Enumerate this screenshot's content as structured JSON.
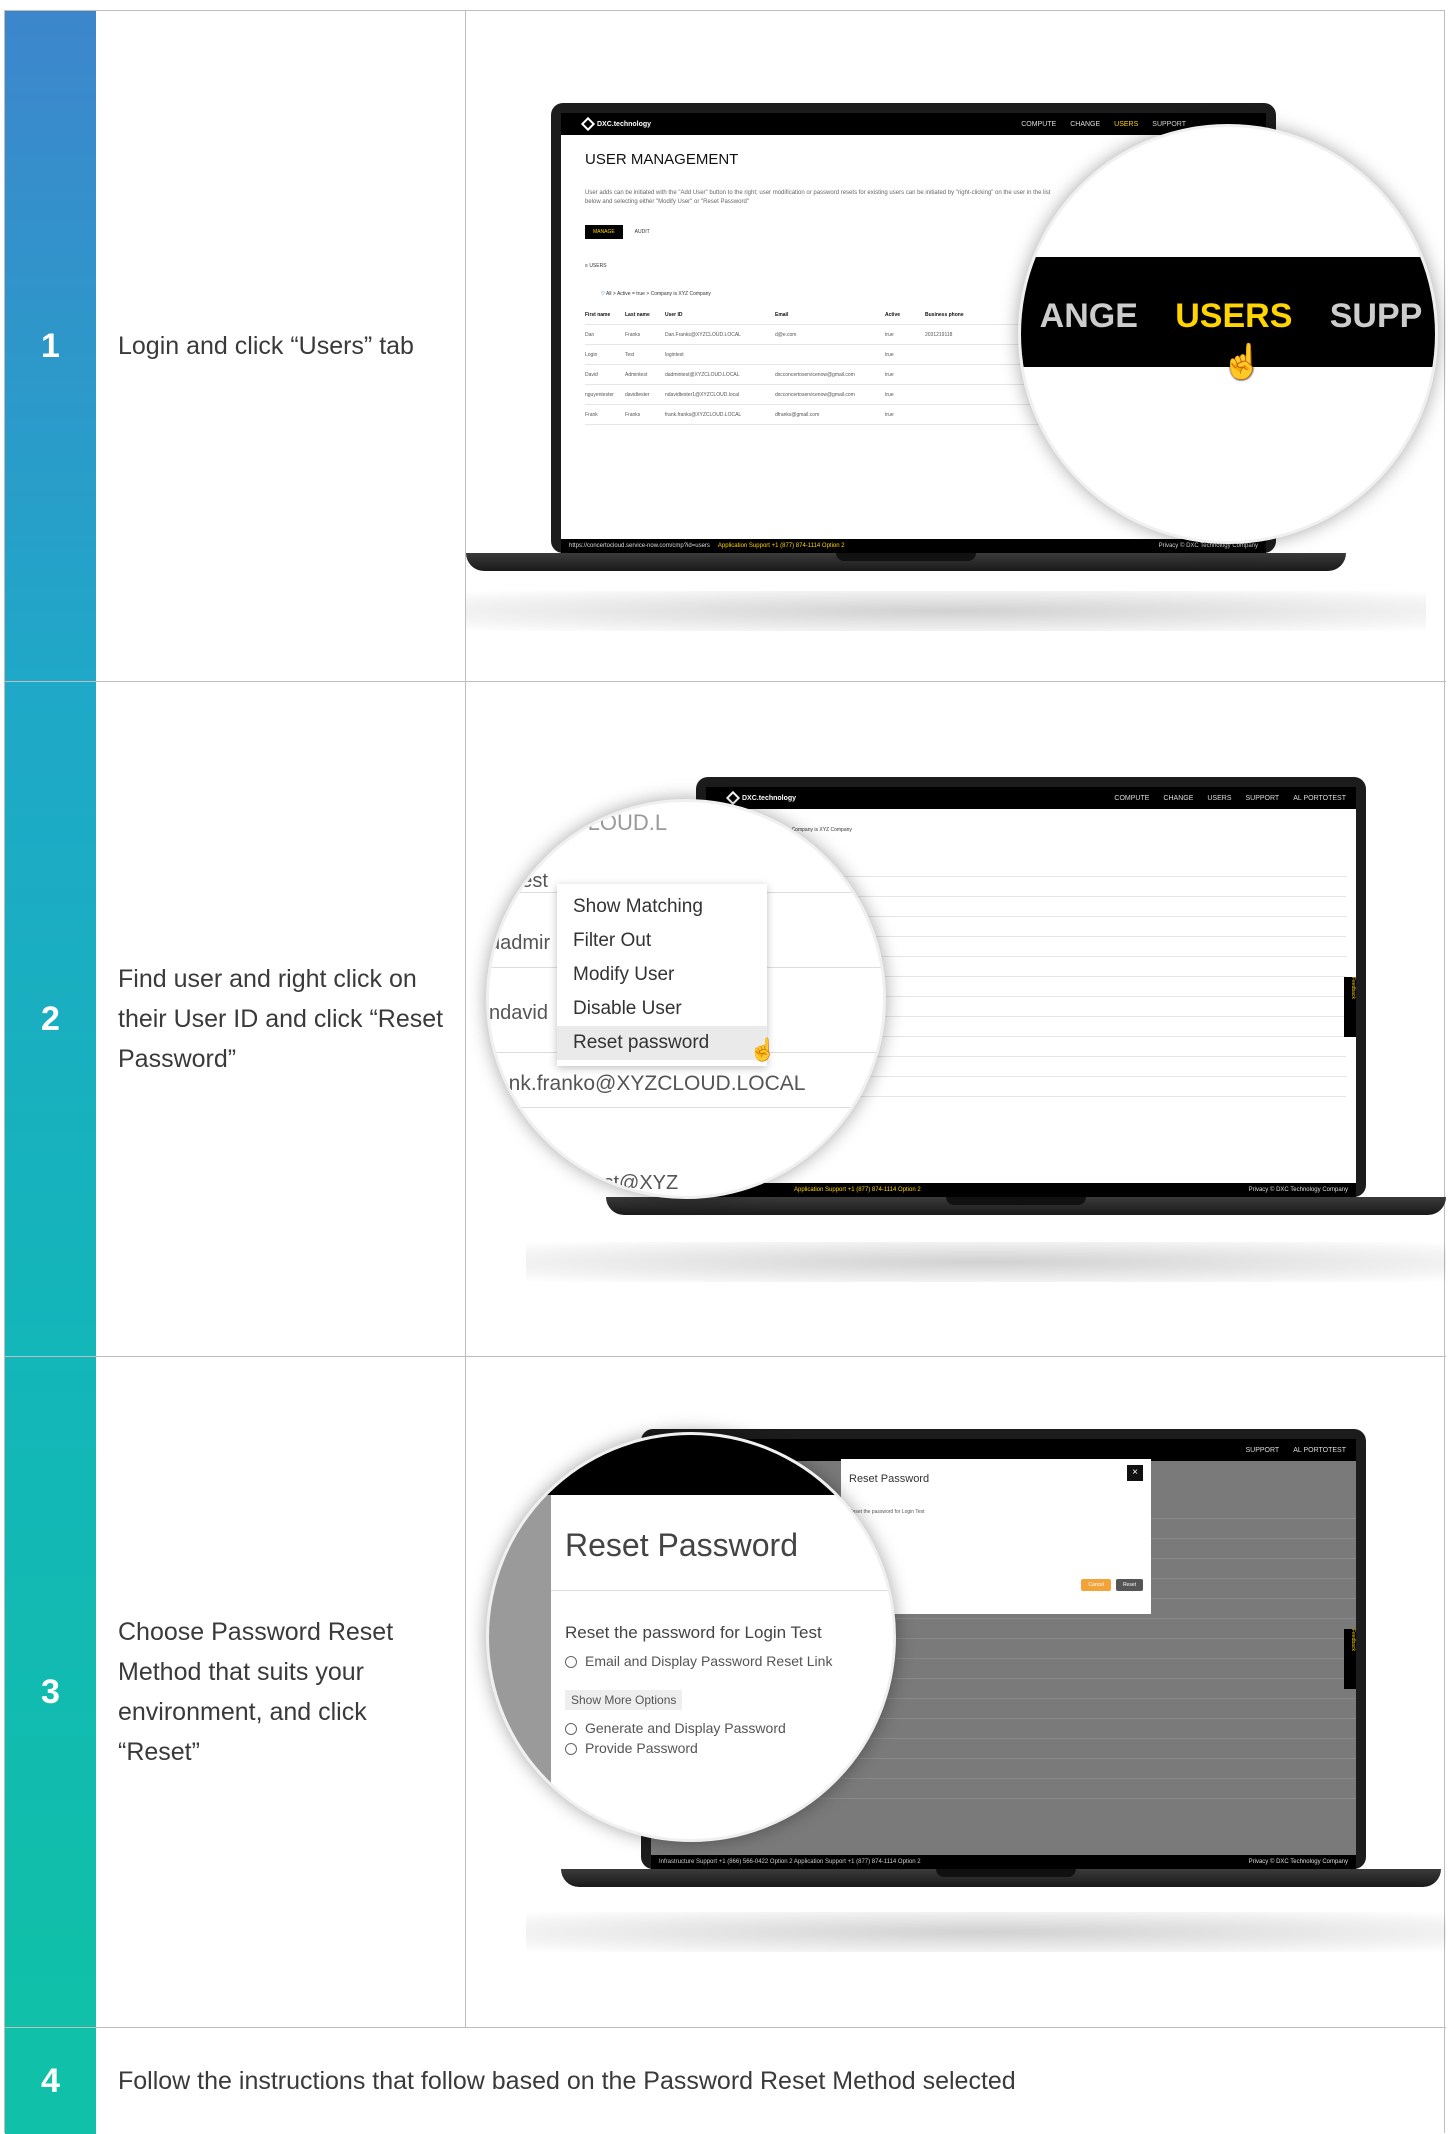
{
  "colors": {
    "step1": "#2e8fcf",
    "step2": "#13afc0",
    "step3": "#12bcae",
    "step4": "#10c0a8",
    "brand_yellow": "#ffd400"
  },
  "steps": [
    {
      "number": "1",
      "text": "Login and click “Users” tab"
    },
    {
      "number": "2",
      "text": "Find user and right click on their User ID and click “Reset Password”"
    },
    {
      "number": "3",
      "text": "Choose Password Reset Method that suits your environment, and click “Reset”"
    },
    {
      "number": "4",
      "text": "Follow the instructions that follow based on the Password Reset Method selected"
    }
  ],
  "screenshot1": {
    "brand": "DXC.technology",
    "nav": [
      "COMPUTE",
      "CHANGE",
      "USERS",
      "SUPPORT"
    ],
    "title": "USER MANAGEMENT",
    "description": "User adds can be initiated with the \"Add User\" button to the right; user modification or password resets for existing users can be initiated by \"right-clicking\" on the user in the list below and selecting either \"Modify User\" or \"Reset Password\"",
    "tabs": [
      "MANAGE",
      "AUDIT"
    ],
    "section": "USERS",
    "filter": "All > Active = true > Company is XYZ Company",
    "columns": [
      "First name",
      "Last name",
      "User ID",
      "Email",
      "Active",
      "Business phone"
    ],
    "rows": [
      [
        "Dan",
        "Franks",
        "Dan.Franks@XYZCLOUD.LOCAL",
        "d@e.com",
        "true",
        "2031219118"
      ],
      [
        "Login",
        "Test",
        "logintest",
        "",
        "true",
        ""
      ],
      [
        "David",
        "Admintest",
        "dadmintest@XYZCLOUD.LOCAL",
        "dxcconcertoservicenow@gmail.com",
        "true",
        ""
      ],
      [
        "nguyentester",
        "davidtester",
        "ndavidtester1@XYZCLOUD.local",
        "dxcconcertoservicenow@gmail.com",
        "true",
        ""
      ],
      [
        "Frank",
        "Franks",
        "frank.franks@XYZCLOUD.LOCAL",
        "dfranks@gmail.com",
        "true",
        ""
      ]
    ],
    "magnified": [
      "ANGE",
      "USERS",
      "SUPP"
    ],
    "footer_url": "https://concertocloud.service-now.com/cmp?id=users",
    "footer_support": "Application Support +1 (877) 874-1114 Option 2",
    "footer_right": "Privacy  © DXC Technology Company"
  },
  "screenshot2": {
    "filter": "All > Active = true > Company is XYZ Company",
    "menu": [
      "Show Matching",
      "Filter Out",
      "Modify User",
      "Disable User",
      "Reset password"
    ],
    "magnified_rows": [
      "XYZCLOUD.L",
      "gintest",
      "dadmir",
      "ndavid",
      "ank.franko@XYZCLOUD.LOCAL",
      "rtaltest@XYZ"
    ],
    "nav": [
      "COMPUTE",
      "CHANGE",
      "USERS",
      "SUPPORT",
      "AL PORTOTEST"
    ],
    "footer_support": "Application Support +1 (877) 874-1114 Option 2",
    "footer_right": "Privacy  © DXC Technology Company",
    "feedback": "Feedback"
  },
  "screenshot3": {
    "dialog_title": "Reset Password",
    "prompt": "Reset the password for Login Test",
    "option1": "Email and Display Password Reset Link",
    "more": "Show More Options",
    "option2": "Generate and Display Password",
    "option3": "Provide Password",
    "cancel": "Cancel",
    "reset": "Reset",
    "nav": [
      "SUPPORT",
      "AL PORTOTEST"
    ],
    "footer_support": "Infrastructure Support +1 (866) 566-0422 Option 2   Application Support +1 (877) 874-1114 Option 2",
    "footer_right": "Privacy  © DXC Technology Company",
    "feedback": "Feedback"
  }
}
